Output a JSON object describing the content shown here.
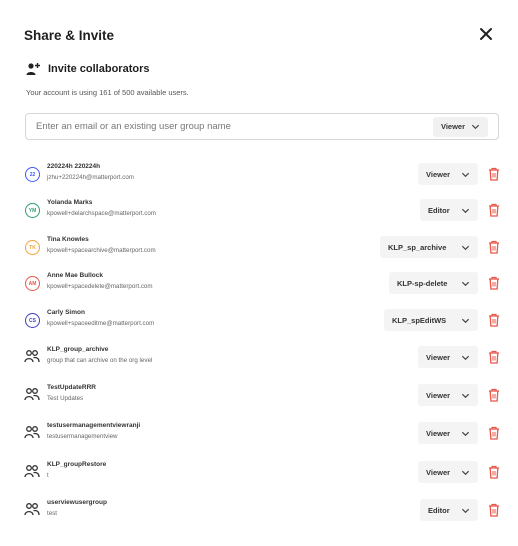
{
  "dialog": {
    "title": "Share & Invite",
    "invite_heading": "Invite collaborators",
    "usage_text": "Your account is using 161 of 500 available users.",
    "search_placeholder": "Enter an email or an existing user group name",
    "search_role": "Viewer"
  },
  "colors": {
    "delete": "#e8574a",
    "avatar_blue": "#3d5afe",
    "avatar_green": "#2e9e6e",
    "avatar_orange": "#f2a33a",
    "avatar_red": "#e8574a",
    "avatar_indigo": "#3f3fbf"
  },
  "members": [
    {
      "type": "user",
      "initials": "22",
      "color": "#3d5afe",
      "name": "220224h 220224h",
      "sub": "jzhu+220224h@matterport.com",
      "role": "Viewer"
    },
    {
      "type": "user",
      "initials": "YM",
      "color": "#2e9e6e",
      "name": "Yolanda Marks",
      "sub": "kpowell+delarchspace@matterport.com",
      "role": "Editor"
    },
    {
      "type": "user",
      "initials": "TK",
      "color": "#f2a33a",
      "name": "Tina Knowles",
      "sub": "kpowell+spacearchive@matterport.com",
      "role": "KLP_sp_archive"
    },
    {
      "type": "user",
      "initials": "AM",
      "color": "#e8574a",
      "name": "Anne Mae Bullock",
      "sub": "kpowell+spacedelete@matterport.com",
      "role": "KLP-sp-delete"
    },
    {
      "type": "user",
      "initials": "CS",
      "color": "#3f3fbf",
      "name": "Carly Simon",
      "sub": "kpowell+spaceeditme@matterport.com",
      "role": "KLP_spEditWS"
    },
    {
      "type": "group",
      "name": "KLP_group_archive",
      "sub": "group that can archive on the org level",
      "role": "Viewer"
    },
    {
      "type": "group",
      "name": "TestUpdateRRR",
      "sub": "Test Updates",
      "role": "Viewer"
    },
    {
      "type": "group",
      "name": "testusermanagementviewranji",
      "sub": "testusermanagementview",
      "role": "Viewer"
    },
    {
      "type": "group",
      "name": "KLP_groupRestore",
      "sub": "t",
      "role": "Viewer"
    },
    {
      "type": "group",
      "name": "userviewusergroup",
      "sub": "test",
      "role": "Editor"
    }
  ]
}
